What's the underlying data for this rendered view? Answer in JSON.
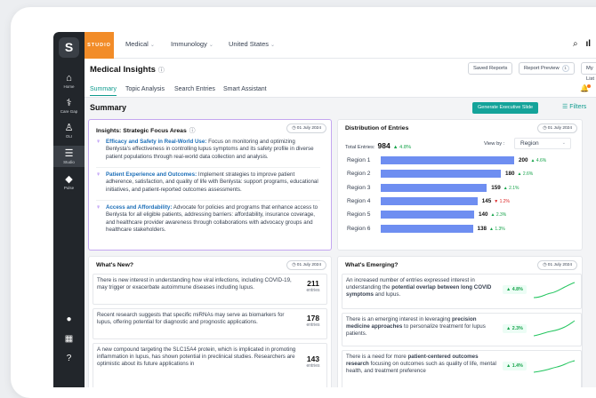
{
  "sidebar": {
    "items": [
      {
        "label": "Home",
        "icon": "home-icon",
        "glyph": "⌂"
      },
      {
        "label": "Care Gap",
        "icon": "care-gap-icon",
        "glyph": "⚕"
      },
      {
        "label": "OLI",
        "icon": "person-icon",
        "glyph": "♙"
      },
      {
        "label": "Studio",
        "icon": "studio-icon",
        "glyph": "☰"
      },
      {
        "label": "Pulse",
        "icon": "pulse-icon",
        "glyph": "◆"
      }
    ],
    "bottom": [
      {
        "icon": "user-icon",
        "glyph": "●"
      },
      {
        "icon": "grid-icon",
        "glyph": "▦"
      },
      {
        "icon": "help-icon",
        "glyph": "?"
      }
    ]
  },
  "topbar": {
    "studio": "STUDIO",
    "menus": [
      "Medical",
      "Immunology",
      "United States"
    ]
  },
  "header": {
    "title": "Medical Insights",
    "buttons": {
      "saved": "Saved Reports",
      "preview": "Report Preview",
      "preview_badge": "1",
      "mylist": "My List"
    }
  },
  "tabs": [
    "Summary",
    "Topic Analysis",
    "Search Entries",
    "Smart Assistant"
  ],
  "summary": {
    "title": "Summary",
    "generate": "Generate Executive Slide",
    "filters": "Filters"
  },
  "insights": {
    "title": "Insights: Strategic Focus Areas",
    "date": "01 July 2024",
    "items": [
      {
        "head": "Efficacy and Safety in Real-World Use:",
        "body": " Focus on monitoring and optimizing Benlysta's effectiveness in controlling lupus symptoms and its safety profile in diverse patient populations through real-world data collection and analysis."
      },
      {
        "head": "Patient Experience and Outcomes:",
        "body": " Implement strategies to improve patient adherence, satisfaction, and quality of life with Benlysta: support programs, educational initiatives, and patient-reported outcomes assessments."
      },
      {
        "head": "Access and Affordability:",
        "body": " Advocate for policies and programs that enhance access to Benlysta for all eligible patients, addressing barriers: affordability, insurance coverage, and healthcare provider awareness through collaborations with advocacy groups and healthcare stakeholders."
      }
    ]
  },
  "distribution": {
    "title": "Distribution of Entries",
    "date": "01 July 2024",
    "total_label": "Total Entries:",
    "total": "984",
    "total_change": "▲ 4.8%",
    "viewby_label": "View by :",
    "viewby": "Region"
  },
  "chart_data": {
    "type": "bar",
    "orientation": "horizontal",
    "categories": [
      "Region 1",
      "Region 2",
      "Region 3",
      "Region 4",
      "Region 5",
      "Region 6"
    ],
    "values": [
      200,
      180,
      159,
      145,
      140,
      138
    ],
    "changes": [
      "▲ 4.6%",
      "▲ 2.6%",
      "▲ 2.1%",
      "▼ 1.2%",
      "▲ 2.3%",
      "▲ 1.3%"
    ],
    "directions": [
      "up",
      "up",
      "up",
      "down",
      "up",
      "up"
    ],
    "xmax": 200,
    "bar_color": "#6e8ef1"
  },
  "whatsnew": {
    "title": "What's New?",
    "date": "01 July 2024",
    "items": [
      {
        "text": "There is new interest in understanding how viral infections, including COVID-19, may trigger or exacerbate autoimmune diseases including lupus.",
        "count": "211",
        "unit": "entries"
      },
      {
        "text": "Recent research suggests that specific miRNAs may serve as biomarkers for lupus, offering potential for diagnostic and prognostic applications.",
        "count": "178",
        "unit": "entries"
      },
      {
        "text": "A new compound targeting the SLC15A4 protein, which is implicated in promoting inflammation in lupus, has shown potential in preclinical studies. Researchers are optimistic about its future applications in",
        "count": "143",
        "unit": "entries"
      }
    ]
  },
  "emerging": {
    "title": "What's Emerging?",
    "date": "01 July 2024",
    "items": [
      {
        "pre": "An increased number of entries expressed interest in understanding the ",
        "bold": "potential overlap between long COVID symptoms",
        "post": " and lupus.",
        "change": "▲ 4.8%"
      },
      {
        "pre": "There is an emerging interest in leveraging ",
        "bold": "precision medicine approaches",
        "post": " to personalize treatment for lupus patients.",
        "change": "▲ 2.3%"
      },
      {
        "pre": "There is a need for more ",
        "bold": "patient-centered outcomes research",
        "post": " focusing on outcomes such as quality of life, mental health, and treatment preference",
        "change": "▲ 1.4%"
      }
    ]
  }
}
